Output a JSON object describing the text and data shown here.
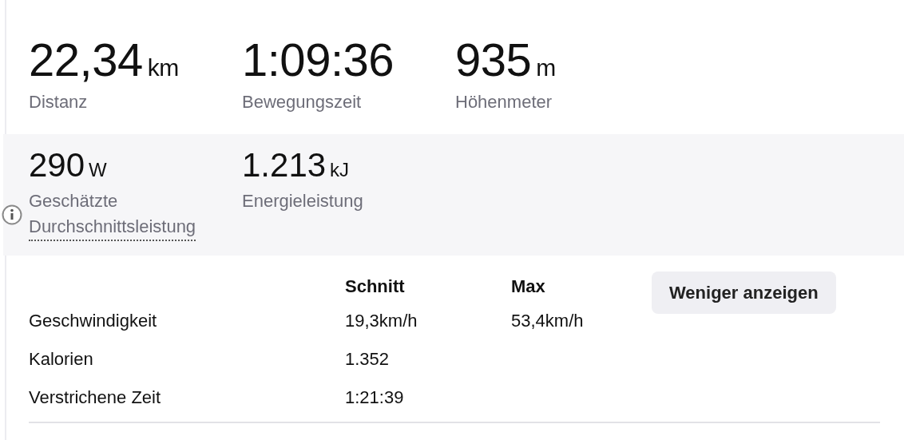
{
  "primary_stats": [
    {
      "value": "22,34",
      "unit": "km",
      "label": "Distanz"
    },
    {
      "value": "1:09:36",
      "label": "Bewegungszeit"
    },
    {
      "value": "935",
      "unit": "m",
      "label": "Höhenmeter"
    }
  ],
  "secondary_stats": [
    {
      "value": "290",
      "unit": "W",
      "label": "Geschätzte Durchschnittsleistung",
      "info": true
    },
    {
      "value": "1.213",
      "unit": "kJ",
      "label": "Energieleistung",
      "info": false
    }
  ],
  "details": {
    "columns": [
      "Schnitt",
      "Max"
    ],
    "rows": [
      {
        "label": "Geschwindigkeit",
        "avg": "19,3km/h",
        "max": "53,4km/h"
      },
      {
        "label": "Kalorien",
        "avg": "1.352"
      },
      {
        "label": "Verstrichene Zeit",
        "avg": "1:21:39"
      }
    ]
  },
  "toggle_button": "Weniger anzeigen"
}
